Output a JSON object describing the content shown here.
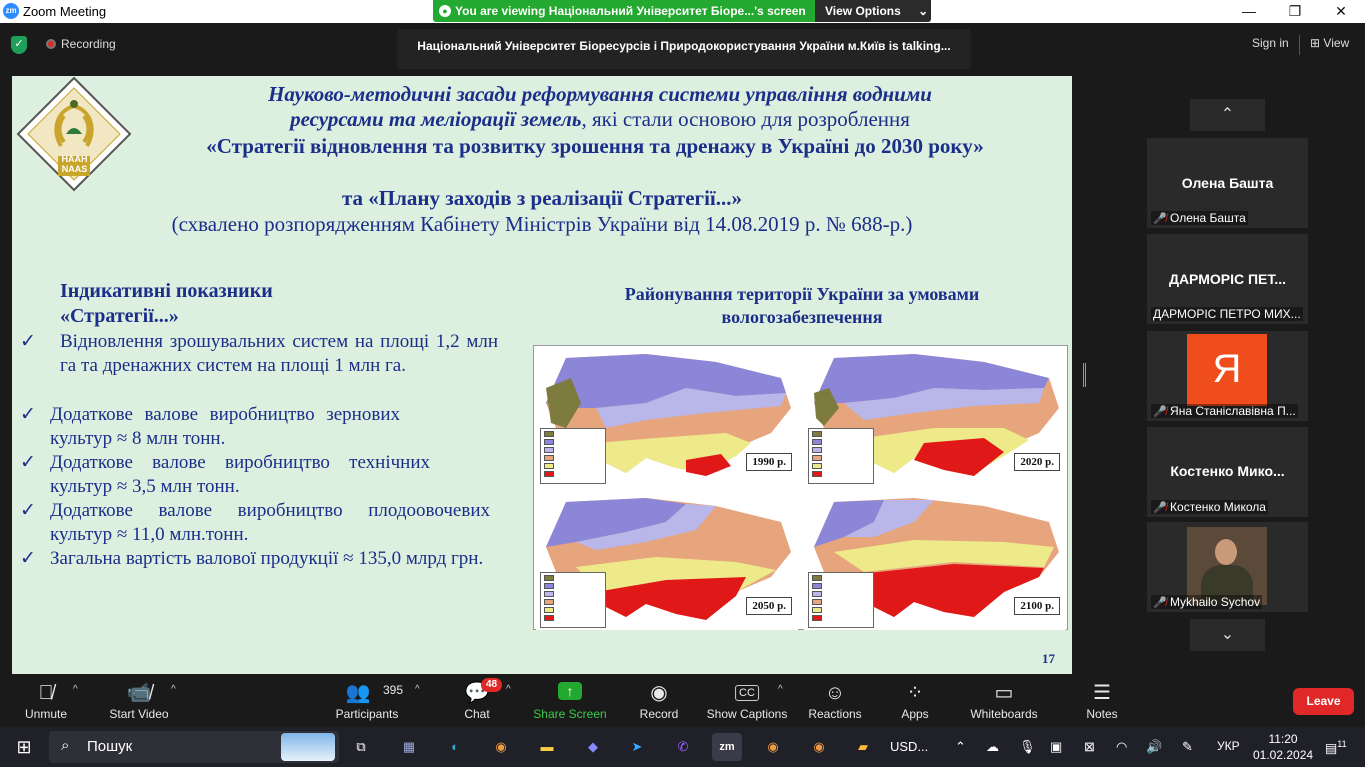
{
  "titlebar": {
    "app_title": "Zoom Meeting",
    "logo_text": "zm",
    "minimize": "—",
    "maximize": "❐",
    "close": "✕"
  },
  "banner": {
    "text": "You are viewing Національний Університет Біоре...'s screen",
    "view_options": "View Options",
    "chev": "⌄"
  },
  "topbar": {
    "recording": "Recording",
    "talking": "Національний Університет Біоресурсів і Природокористування України м.Київ is talking...",
    "sign_in": "Sign in",
    "view": "View"
  },
  "slide": {
    "logo_text_1": "НААН",
    "logo_text_2": "NAAS",
    "title_line1": "Науково-методичні засади реформування системи управління водними",
    "title_line2a": "ресурсами та меліорації земель",
    "title_line2b": ", які стали основою для розроблення",
    "title_line3": "«Стратегії відновлення та розвитку зрошення та дренажу в Україні до 2030 року»",
    "title_line4": "та «Плану заходів з реалізації Стратегії...»",
    "title_line5": "(схвалено розпорядженням Кабінету Міністрів України від 14.08.2019 р. № 688-р.)",
    "ind_title": "Індикативні показники «Стратегії...»",
    "bullets": [
      "Відновлення зрошувальних систем на площі 1,2 млн га та дренажних систем на площі 1 млн га.",
      "Додаткове валове виробництво зернових культур ≈ 8 млн тонн.",
      "Додаткове валове виробництво технічних культур ≈ 3,5 млн тонн.",
      "Додаткове валове виробництво плодоовочевих культур ≈ 11,0 млн.тонн.",
      "Загальна вартість валової продукції ≈ 135,0 млрд грн."
    ],
    "check": "✓",
    "map_title": "Районування території України за умовами вологозабезпечення",
    "years": [
      "1990 р.",
      "2020 р.",
      "2050 р.",
      "2100 р."
    ],
    "page": "17"
  },
  "sidebar": {
    "up": "⌃",
    "down": "⌄",
    "tiles": [
      {
        "name": "Олена Башта",
        "label": "Олена Башта"
      },
      {
        "name": "ДАРМОРІС ПЕТ...",
        "label": "ДАРМОРІС ПЕТРО МИХ..."
      },
      {
        "name": "Я",
        "label": "Яна Станіславівна П..."
      },
      {
        "name": "Костенко  Мико...",
        "label": "Костенко Микола"
      },
      {
        "name": "",
        "label": "Mykhailo Sychov"
      }
    ]
  },
  "controls": {
    "unmute": "Unmute",
    "start_video": "Start Video",
    "participants": "Participants",
    "participants_count": "395",
    "chat": "Chat",
    "chat_badge": "48",
    "share": "Share Screen",
    "record": "Record",
    "captions": "Show Captions",
    "reactions": "Reactions",
    "apps": "Apps",
    "whiteboards": "Whiteboards",
    "notes": "Notes",
    "leave": "Leave",
    "caret": "^"
  },
  "taskbar": {
    "search": "Пошук",
    "stock": "USD...",
    "lang": "УКР",
    "time": "11:20",
    "date": "01.02.2024",
    "notif": "11"
  },
  "colors": {
    "accent": "#2d8cff",
    "share_green": "#23a830",
    "leave_red": "#e02828",
    "slide_bg": "#ddf0e0",
    "slide_text": "#1a2e8a"
  }
}
